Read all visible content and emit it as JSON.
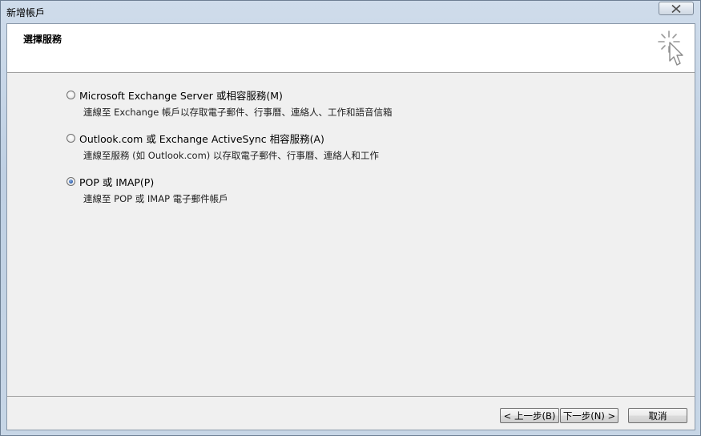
{
  "window": {
    "title": "新增帳戶"
  },
  "header": {
    "title": "選擇服務",
    "icon": "wizard-cursor-icon"
  },
  "options": [
    {
      "label": "Microsoft Exchange Server 或相容服務(M)",
      "description": "連線至 Exchange 帳戶以存取電子郵件、行事曆、連絡人、工作和語音信箱",
      "checked": false
    },
    {
      "label": "Outlook.com 或 Exchange ActiveSync 相容服務(A)",
      "description": "連線至服務 (如 Outlook.com) 以存取電子郵件、行事曆、連絡人和工作",
      "checked": false
    },
    {
      "label": "POP 或 IMAP(P)",
      "description": "連線至 POP 或 IMAP 電子郵件帳戶",
      "checked": true
    }
  ],
  "buttons": {
    "back": "< 上一步(B)",
    "next": "下一步(N) >",
    "cancel": "取消"
  },
  "colors": {
    "radio_selected": "#2a5aa8",
    "client_bg": "#f0f0f0",
    "header_bg": "#ffffff"
  }
}
